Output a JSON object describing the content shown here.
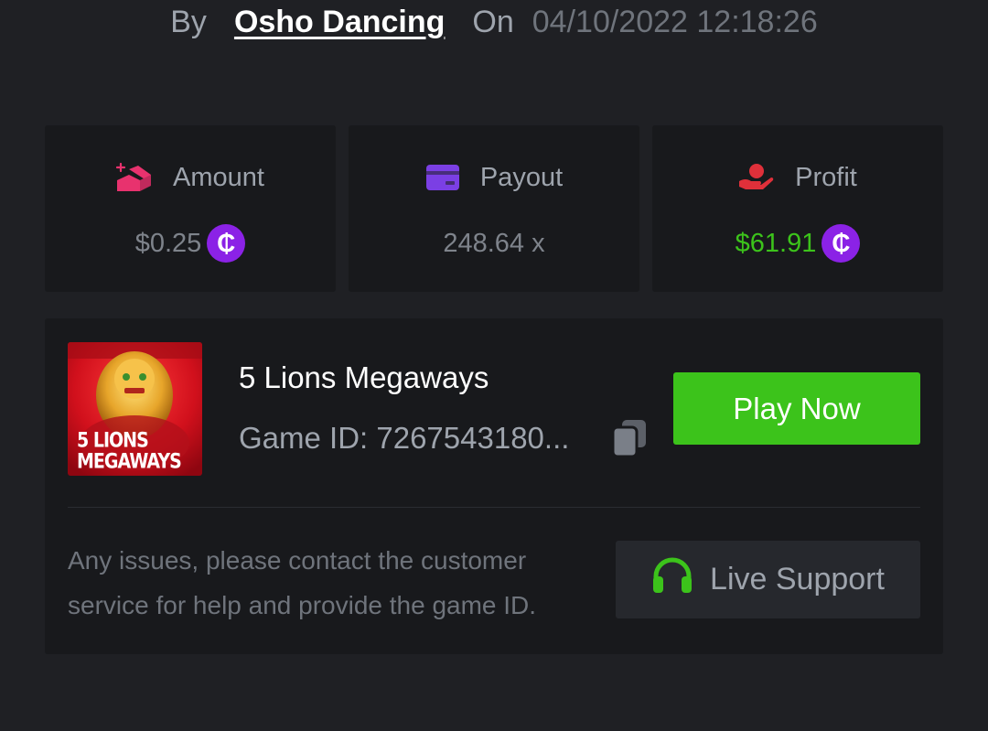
{
  "header": {
    "by_label": "By",
    "username": "Osho Dancing",
    "on_label": "On",
    "datetime": "04/10/2022 12:18:26"
  },
  "stats": [
    {
      "label": "Amount",
      "value": "$0.25",
      "icon": "bet-amount-icon",
      "coin": "₵",
      "color": "#7e838b"
    },
    {
      "label": "Payout",
      "value": "248.64 x",
      "icon": "card-icon"
    },
    {
      "label": "Profit",
      "value": "$61.91",
      "icon": "hand-coin-icon",
      "coin": "₵",
      "color": "#3cc31b"
    }
  ],
  "game": {
    "title": "5 Lions Megaways",
    "game_id": "Game ID: 7267543180...",
    "thumb_text": "5 LIONS\nMEGAWAYS",
    "play_label": "Play Now"
  },
  "support": {
    "help_text": "Any issues, please contact the customer service for help and provide the game ID.",
    "button_label": "Live Support"
  },
  "colors": {
    "background": "#1f2024",
    "card": "#18191c",
    "accent_green": "#3cc31b",
    "coin_purple": "#8b22e6",
    "amount_icon_pink": "#e8326e",
    "payout_icon_purple": "#7b3fe4",
    "profit_icon_red": "#e0303a"
  }
}
